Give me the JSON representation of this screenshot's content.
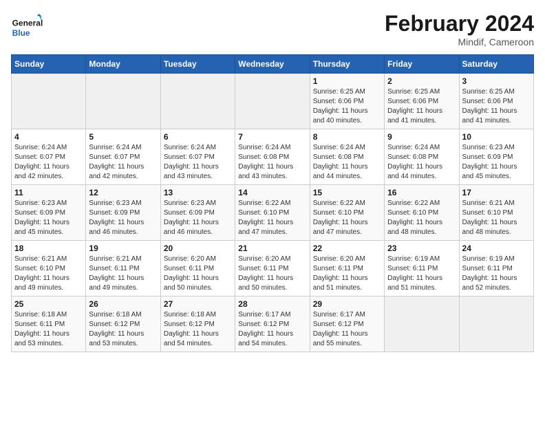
{
  "header": {
    "logo_line1": "General",
    "logo_line2": "Blue",
    "month_title": "February 2024",
    "location": "Mindif, Cameroon"
  },
  "weekdays": [
    "Sunday",
    "Monday",
    "Tuesday",
    "Wednesday",
    "Thursday",
    "Friday",
    "Saturday"
  ],
  "weeks": [
    [
      {
        "day": "",
        "info": ""
      },
      {
        "day": "",
        "info": ""
      },
      {
        "day": "",
        "info": ""
      },
      {
        "day": "",
        "info": ""
      },
      {
        "day": "1",
        "info": "Sunrise: 6:25 AM\nSunset: 6:06 PM\nDaylight: 11 hours\nand 40 minutes."
      },
      {
        "day": "2",
        "info": "Sunrise: 6:25 AM\nSunset: 6:06 PM\nDaylight: 11 hours\nand 41 minutes."
      },
      {
        "day": "3",
        "info": "Sunrise: 6:25 AM\nSunset: 6:06 PM\nDaylight: 11 hours\nand 41 minutes."
      }
    ],
    [
      {
        "day": "4",
        "info": "Sunrise: 6:24 AM\nSunset: 6:07 PM\nDaylight: 11 hours\nand 42 minutes."
      },
      {
        "day": "5",
        "info": "Sunrise: 6:24 AM\nSunset: 6:07 PM\nDaylight: 11 hours\nand 42 minutes."
      },
      {
        "day": "6",
        "info": "Sunrise: 6:24 AM\nSunset: 6:07 PM\nDaylight: 11 hours\nand 43 minutes."
      },
      {
        "day": "7",
        "info": "Sunrise: 6:24 AM\nSunset: 6:08 PM\nDaylight: 11 hours\nand 43 minutes."
      },
      {
        "day": "8",
        "info": "Sunrise: 6:24 AM\nSunset: 6:08 PM\nDaylight: 11 hours\nand 44 minutes."
      },
      {
        "day": "9",
        "info": "Sunrise: 6:24 AM\nSunset: 6:08 PM\nDaylight: 11 hours\nand 44 minutes."
      },
      {
        "day": "10",
        "info": "Sunrise: 6:23 AM\nSunset: 6:09 PM\nDaylight: 11 hours\nand 45 minutes."
      }
    ],
    [
      {
        "day": "11",
        "info": "Sunrise: 6:23 AM\nSunset: 6:09 PM\nDaylight: 11 hours\nand 45 minutes."
      },
      {
        "day": "12",
        "info": "Sunrise: 6:23 AM\nSunset: 6:09 PM\nDaylight: 11 hours\nand 46 minutes."
      },
      {
        "day": "13",
        "info": "Sunrise: 6:23 AM\nSunset: 6:09 PM\nDaylight: 11 hours\nand 46 minutes."
      },
      {
        "day": "14",
        "info": "Sunrise: 6:22 AM\nSunset: 6:10 PM\nDaylight: 11 hours\nand 47 minutes."
      },
      {
        "day": "15",
        "info": "Sunrise: 6:22 AM\nSunset: 6:10 PM\nDaylight: 11 hours\nand 47 minutes."
      },
      {
        "day": "16",
        "info": "Sunrise: 6:22 AM\nSunset: 6:10 PM\nDaylight: 11 hours\nand 48 minutes."
      },
      {
        "day": "17",
        "info": "Sunrise: 6:21 AM\nSunset: 6:10 PM\nDaylight: 11 hours\nand 48 minutes."
      }
    ],
    [
      {
        "day": "18",
        "info": "Sunrise: 6:21 AM\nSunset: 6:10 PM\nDaylight: 11 hours\nand 49 minutes."
      },
      {
        "day": "19",
        "info": "Sunrise: 6:21 AM\nSunset: 6:11 PM\nDaylight: 11 hours\nand 49 minutes."
      },
      {
        "day": "20",
        "info": "Sunrise: 6:20 AM\nSunset: 6:11 PM\nDaylight: 11 hours\nand 50 minutes."
      },
      {
        "day": "21",
        "info": "Sunrise: 6:20 AM\nSunset: 6:11 PM\nDaylight: 11 hours\nand 50 minutes."
      },
      {
        "day": "22",
        "info": "Sunrise: 6:20 AM\nSunset: 6:11 PM\nDaylight: 11 hours\nand 51 minutes."
      },
      {
        "day": "23",
        "info": "Sunrise: 6:19 AM\nSunset: 6:11 PM\nDaylight: 11 hours\nand 51 minutes."
      },
      {
        "day": "24",
        "info": "Sunrise: 6:19 AM\nSunset: 6:11 PM\nDaylight: 11 hours\nand 52 minutes."
      }
    ],
    [
      {
        "day": "25",
        "info": "Sunrise: 6:18 AM\nSunset: 6:11 PM\nDaylight: 11 hours\nand 53 minutes."
      },
      {
        "day": "26",
        "info": "Sunrise: 6:18 AM\nSunset: 6:12 PM\nDaylight: 11 hours\nand 53 minutes."
      },
      {
        "day": "27",
        "info": "Sunrise: 6:18 AM\nSunset: 6:12 PM\nDaylight: 11 hours\nand 54 minutes."
      },
      {
        "day": "28",
        "info": "Sunrise: 6:17 AM\nSunset: 6:12 PM\nDaylight: 11 hours\nand 54 minutes."
      },
      {
        "day": "29",
        "info": "Sunrise: 6:17 AM\nSunset: 6:12 PM\nDaylight: 11 hours\nand 55 minutes."
      },
      {
        "day": "",
        "info": ""
      },
      {
        "day": "",
        "info": ""
      }
    ]
  ]
}
